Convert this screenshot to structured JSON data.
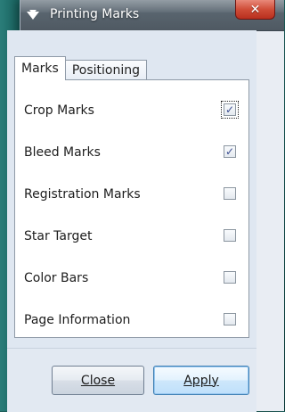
{
  "window": {
    "title": "Printing Marks",
    "close_glyph": "✕"
  },
  "tabs": [
    {
      "label": "Marks",
      "active": true
    },
    {
      "label": "Positioning",
      "active": false
    }
  ],
  "marks": [
    {
      "label": "Crop Marks",
      "checked": true,
      "glyph": "✓"
    },
    {
      "label": "Bleed Marks",
      "checked": true,
      "glyph": "✓"
    },
    {
      "label": "Registration Marks",
      "checked": false,
      "glyph": ""
    },
    {
      "label": "Star Target",
      "checked": false,
      "glyph": ""
    },
    {
      "label": "Color Bars",
      "checked": false,
      "glyph": ""
    },
    {
      "label": "Page Information",
      "checked": false,
      "glyph": ""
    }
  ],
  "buttons": {
    "close_label": "Close",
    "apply_label": "Apply"
  },
  "colors": {
    "titlebar": "#59656f",
    "dialog_bg": "#e9edf3",
    "panel_bg": "#ffffff",
    "accent": "#3f7fb3"
  },
  "icons": {
    "title_icon": "printer-marks-icon",
    "close_icon": "close-icon",
    "check_icon": "check-icon"
  }
}
